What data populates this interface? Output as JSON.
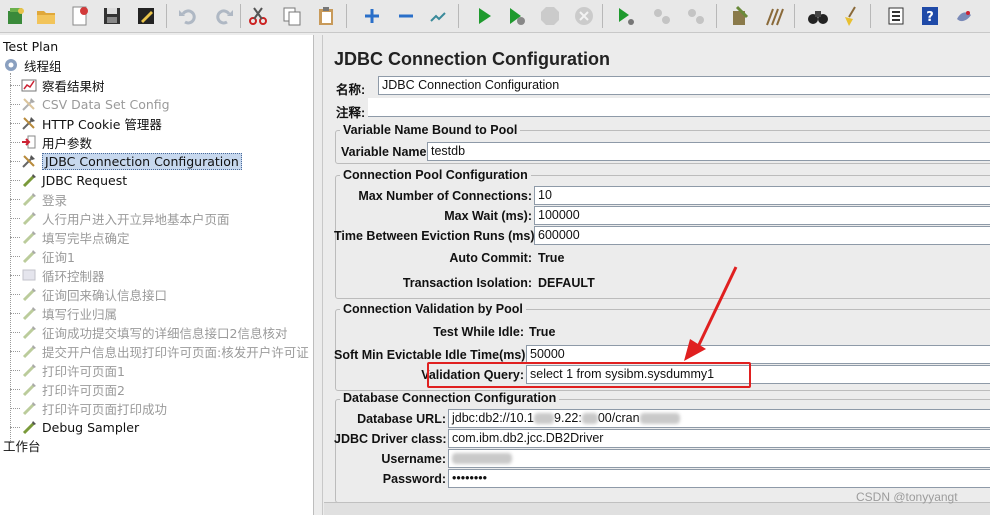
{
  "toolbar": {
    "buttons": [
      {
        "icon": "new-template-icon",
        "enabled": true
      },
      {
        "icon": "open-folder-icon",
        "enabled": true
      },
      {
        "icon": "close-document-icon",
        "enabled": true
      },
      {
        "icon": "save-icon",
        "enabled": true
      },
      {
        "icon": "save-screenshot-icon",
        "enabled": true
      },
      {
        "icon": "undo-icon",
        "enabled": false
      },
      {
        "icon": "redo-icon",
        "enabled": false
      },
      {
        "icon": "cut-icon",
        "enabled": true
      },
      {
        "icon": "copy-icon",
        "enabled": true
      },
      {
        "icon": "paste-icon",
        "enabled": true
      },
      {
        "icon": "expand-icon",
        "enabled": true
      },
      {
        "icon": "collapse-icon",
        "enabled": true
      },
      {
        "icon": "toggle-icon",
        "enabled": true
      },
      {
        "icon": "start-icon",
        "enabled": true
      },
      {
        "icon": "start-no-pause-icon",
        "enabled": true
      },
      {
        "icon": "stop-icon",
        "enabled": false
      },
      {
        "icon": "shutdown-icon",
        "enabled": false
      },
      {
        "icon": "remote-start-icon",
        "enabled": true
      },
      {
        "icon": "remote-stop-icon",
        "enabled": false
      },
      {
        "icon": "remote-shutdown-icon",
        "enabled": false
      },
      {
        "icon": "clear-icon",
        "enabled": true
      },
      {
        "icon": "clear-all-icon",
        "enabled": true
      },
      {
        "icon": "search-binoculars-icon",
        "enabled": true
      },
      {
        "icon": "reset-search-broom-icon",
        "enabled": true
      },
      {
        "icon": "function-helper-icon",
        "enabled": true
      },
      {
        "icon": "help-icon",
        "enabled": true
      },
      {
        "icon": "logger-icon",
        "enabled": true
      }
    ]
  },
  "tree": {
    "root": "Test Plan",
    "thread_group": "线程组",
    "items": [
      {
        "label": "察看结果树",
        "icon": "listener-icon",
        "enabled": true
      },
      {
        "label": "CSV Data Set Config",
        "icon": "config-icon",
        "enabled": false
      },
      {
        "label": "HTTP Cookie 管理器",
        "icon": "config-icon",
        "enabled": true
      },
      {
        "label": "用户参数",
        "icon": "preprocessor-icon",
        "enabled": true
      },
      {
        "label": "JDBC Connection Configuration",
        "icon": "config-icon",
        "enabled": true,
        "selected": true
      },
      {
        "label": "JDBC Request",
        "icon": "sampler-icon",
        "enabled": true
      },
      {
        "label": "登录",
        "icon": "sampler-icon",
        "enabled": false
      },
      {
        "label": "人行用户进入开立异地基本户页面",
        "icon": "sampler-icon",
        "enabled": false
      },
      {
        "label": "填写完毕点确定",
        "icon": "sampler-icon",
        "enabled": false
      },
      {
        "label": "征询1",
        "icon": "sampler-icon",
        "enabled": false
      },
      {
        "label": "循环控制器",
        "icon": "controller-icon",
        "enabled": false
      },
      {
        "label": "征询回来确认信息接口",
        "icon": "sampler-icon",
        "enabled": false
      },
      {
        "label": "填写行业归属",
        "icon": "sampler-icon",
        "enabled": false
      },
      {
        "label": "征询成功提交填写的详细信息接口2信息核对",
        "icon": "sampler-icon",
        "enabled": false
      },
      {
        "label": "提交开户信息出现打印许可页面:核发开户许可证",
        "icon": "sampler-icon",
        "enabled": false
      },
      {
        "label": "打印许可页面1",
        "icon": "sampler-icon",
        "enabled": false
      },
      {
        "label": "打印许可页面2",
        "icon": "sampler-icon",
        "enabled": false
      },
      {
        "label": "打印许可页面打印成功",
        "icon": "sampler-icon",
        "enabled": false
      },
      {
        "label": "Debug Sampler",
        "icon": "sampler-icon",
        "enabled": true
      }
    ],
    "workbench": "工作台"
  },
  "panel": {
    "title": "JDBC Connection Configuration",
    "name_label": "名称:",
    "name_value": "JDBC Connection Configuration",
    "comment_label": "注释:",
    "comment_value": "",
    "pool_var": {
      "group_title": "Variable Name Bound to Pool",
      "var_label": "Variable Name:",
      "var_value": "testdb"
    },
    "pool_config": {
      "group_title": "Connection Pool Configuration",
      "max_conn_label": "Max Number of Connections:",
      "max_conn_value": "10",
      "max_wait_label": "Max Wait (ms):",
      "max_wait_value": "100000",
      "eviction_label": "Time Between Eviction Runs (ms):",
      "eviction_value": "600000",
      "auto_commit_label": "Auto Commit:",
      "auto_commit_value": "True",
      "isolation_label": "Transaction Isolation:",
      "isolation_value": "DEFAULT"
    },
    "validation": {
      "group_title": "Connection Validation by Pool",
      "test_idle_label": "Test While Idle:",
      "test_idle_value": "True",
      "soft_min_label": "Soft Min Evictable Idle Time(ms):",
      "soft_min_value": "50000",
      "query_label": "Validation Query:",
      "query_value": "select 1 from sysibm.sysdummy1"
    },
    "database": {
      "group_title": "Database Connection Configuration",
      "url_label": "Database URL:",
      "url_value_a": "jdbc:db2://10.1",
      "url_value_b": "9.22:",
      "url_value_c": "00/cran",
      "driver_label": "JDBC Driver class:",
      "driver_value": "com.ibm.db2.jcc.DB2Driver",
      "username_label": "Username:",
      "password_label": "Password:",
      "password_value": "••••••••"
    }
  },
  "watermark": "CSDN @tonyyangt"
}
